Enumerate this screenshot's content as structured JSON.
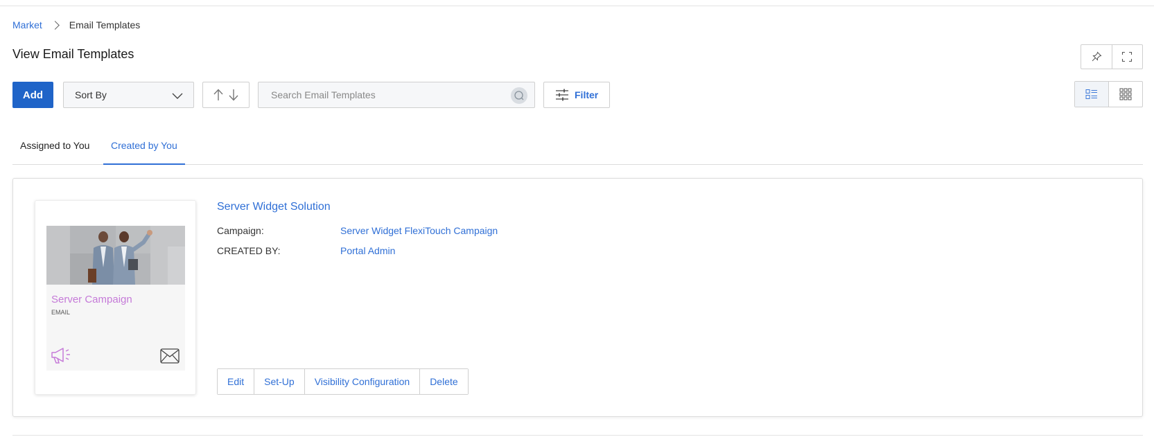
{
  "breadcrumb": {
    "root": "Market",
    "current": "Email Templates"
  },
  "page": {
    "title": "View Email Templates"
  },
  "toolbar": {
    "add_label": "Add",
    "sort_label": "Sort By",
    "search_placeholder": "Search Email Templates",
    "filter_label": "Filter"
  },
  "tabs": [
    {
      "label": "Assigned to You",
      "active": false
    },
    {
      "label": "Created by You",
      "active": true
    }
  ],
  "template": {
    "name": "Server Widget Solution",
    "thumbnail": {
      "title": "Server Campaign",
      "type": "EMAIL"
    },
    "fields": [
      {
        "label": "Campaign:",
        "value": "Server Widget FlexiTouch Campaign"
      },
      {
        "label": "CREATED BY:",
        "value": "Portal Admin"
      }
    ],
    "actions": [
      "Edit",
      "Set-Up",
      "Visibility Configuration",
      "Delete"
    ]
  },
  "icons": {
    "pin": "pin-icon",
    "fullscreen": "fullscreen-icon",
    "list_view": "list-view-icon",
    "grid_view": "grid-view-icon",
    "search": "search-icon",
    "filter": "filter-icon",
    "megaphone": "megaphone-icon",
    "envelope": "envelope-icon"
  },
  "colors": {
    "primary": "#1f64c8",
    "link": "#2f6fd6",
    "thumb_title": "#c57ad8"
  }
}
